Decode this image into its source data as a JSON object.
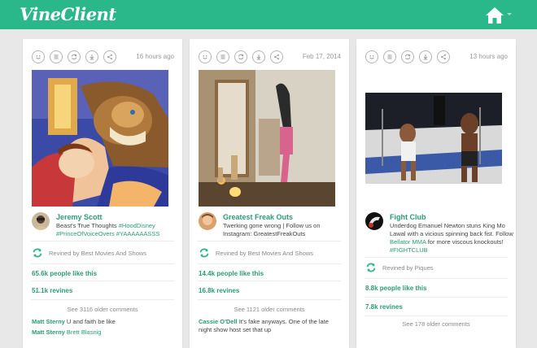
{
  "app": {
    "logo": "VineClient",
    "accent_color": "#2ab88a",
    "home_icon": "home-icon",
    "menu_caret_icon": "chevron-down-icon"
  },
  "action_icons": [
    "like-icon",
    "list-icon",
    "revine-icon",
    "download-icon",
    "share-icon"
  ],
  "posts": [
    {
      "date": "16 hours ago",
      "media_alt": "animated beauty and the beast scene",
      "username": "Jeremy Scott",
      "description_parts": [
        {
          "text": "Beast's True Thoughts ",
          "tag": false
        },
        {
          "text": "#HoodDisney",
          "tag": true
        },
        {
          "text": " ",
          "tag": false
        },
        {
          "text": "#PrinceOfVoiceOvers",
          "tag": true
        },
        {
          "text": " ",
          "tag": false
        },
        {
          "text": "#YAAAAAASSS",
          "tag": true
        }
      ],
      "revined_by": "Revined by Best Movies And Shows",
      "likes": "65.6k people like this",
      "revines": "51.1k revines",
      "older_comments": "See 3116 older comments",
      "comments": [
        {
          "user": "Matt Sterny",
          "text": " U and faith be like"
        },
        {
          "user": "Matt Sterny",
          "text": " Brett Blasnig"
        }
      ]
    },
    {
      "date": "Feb 17, 2014",
      "media_alt": "person handstand next to table",
      "username": "Greatest Freak Outs",
      "description_parts": [
        {
          "text": "Twerking gone wrong | Follow us on Instagram: GreatestFreakOuts",
          "tag": false
        }
      ],
      "revined_by": "Revined by Best Movies And Shows",
      "likes": "14.4k people like this",
      "revines": "16.8k revines",
      "older_comments": "See 1121 older comments",
      "comments": [
        {
          "user": "Cassie O'Dell",
          "text": " It's fake anyways. One of the late night show host set that up"
        }
      ]
    },
    {
      "date": "13 hours ago",
      "media_alt": "MMA fight in cage",
      "username": "Fight Club",
      "description_parts": [
        {
          "text": "Underdog Emanuel Newton stuns King Mo Lawal with a vicious spinning back fist. Follow ",
          "tag": false
        },
        {
          "text": "Bellator MMA",
          "tag": true
        },
        {
          "text": " for more viscous knockouts! ",
          "tag": false
        },
        {
          "text": "#FIGHTCLUB",
          "tag": true
        }
      ],
      "revined_by": "Revined by Piques",
      "likes": "8.8k people like this",
      "revines": "7.8k revines",
      "older_comments": "See 178 older comments",
      "comments": []
    }
  ]
}
